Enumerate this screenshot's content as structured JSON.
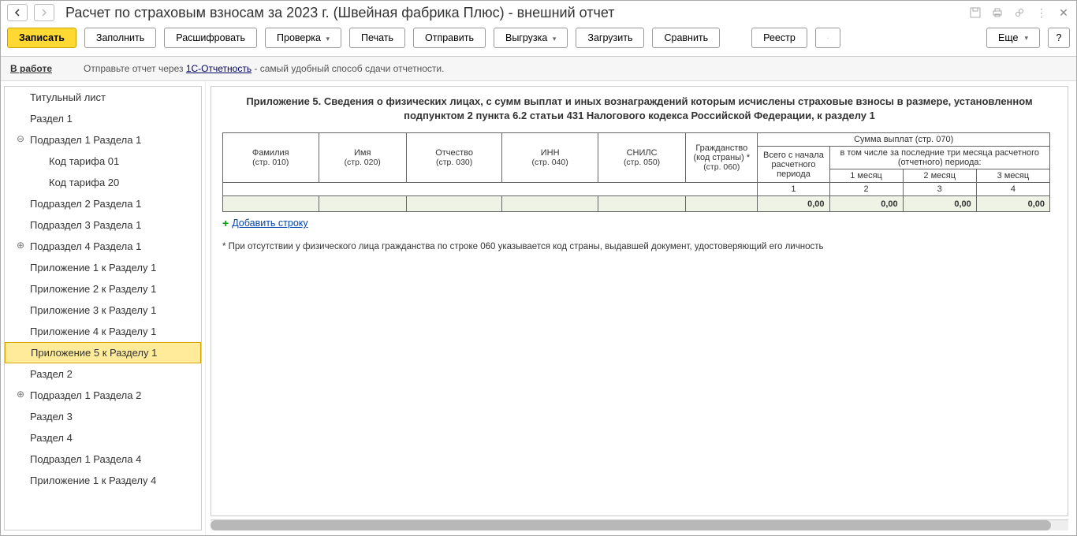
{
  "window": {
    "title": "Расчет по страховым взносам за 2023 г. (Швейная фабрика Плюс) - внешний отчет"
  },
  "toolbar": {
    "save": "Записать",
    "fill": "Заполнить",
    "decode": "Расшифровать",
    "check": "Проверка",
    "print": "Печать",
    "send": "Отправить",
    "export": "Выгрузка",
    "load": "Загрузить",
    "compare": "Сравнить",
    "registry": "Реестр",
    "more": "Еще",
    "help": "?"
  },
  "status": {
    "state": "В работе",
    "msg_pre": "Отправьте отчет через ",
    "msg_link": "1С-Отчетность",
    "msg_post": " - самый удобный способ сдачи отчетности."
  },
  "tree": [
    {
      "label": "Титульный лист",
      "level": 1
    },
    {
      "label": "Раздел 1",
      "level": 1
    },
    {
      "label": "Подраздел 1 Раздела 1",
      "level": 1,
      "exp": "⊖"
    },
    {
      "label": "Код тарифа 01",
      "level": 2
    },
    {
      "label": "Код тарифа 20",
      "level": 2
    },
    {
      "label": "Подраздел 2 Раздела 1",
      "level": 1
    },
    {
      "label": "Подраздел 3 Раздела 1",
      "level": 1
    },
    {
      "label": "Подраздел 4 Раздела 1",
      "level": 1,
      "exp": "⊕"
    },
    {
      "label": "Приложение 1 к Разделу 1",
      "level": 1
    },
    {
      "label": "Приложение 2 к Разделу 1",
      "level": 1
    },
    {
      "label": "Приложение 3 к Разделу 1",
      "level": 1
    },
    {
      "label": "Приложение 4 к Разделу 1",
      "level": 1
    },
    {
      "label": "Приложение 5 к Разделу 1",
      "level": 1,
      "selected": true
    },
    {
      "label": "Раздел 2",
      "level": 1
    },
    {
      "label": "Подраздел 1 Раздела 2",
      "level": 1,
      "exp": "⊕"
    },
    {
      "label": "Раздел 3",
      "level": 1
    },
    {
      "label": "Раздел 4",
      "level": 1
    },
    {
      "label": "Подраздел 1 Раздела 4",
      "level": 1
    },
    {
      "label": "Приложение 1 к Разделу 4",
      "level": 1
    }
  ],
  "sheet": {
    "title": "Приложение 5. Сведения о физических лицах, с сумм выплат и иных вознаграждений которым исчислены страховые взносы в размере, установленном подпунктом 2 пункта 6.2 статьи 431 Налогового кодекса Российской Федерации, к разделу 1",
    "cols": {
      "surname": "Фамилия",
      "surname_s": "(стр. 010)",
      "name": "Имя",
      "name_s": "(стр. 020)",
      "patr": "Отчество",
      "patr_s": "(стр. 030)",
      "inn": "ИНН",
      "inn_s": "(стр. 040)",
      "snils": "СНИЛС",
      "snils_s": "(стр. 050)",
      "citizen": "Гражданство (код страны) *",
      "citizen_s": "(стр. 060)",
      "sum_hdr": "Сумма выплат (стр. 070)",
      "total": "Всего с начала расчетного периода",
      "last3": "в том числе за последние три месяца расчетного (отчетного) периода:",
      "m1": "1 месяц",
      "m2": "2 месяц",
      "m3": "3 месяц",
      "n1": "1",
      "n2": "2",
      "n3": "3",
      "n4": "4"
    },
    "row": {
      "v1": "0,00",
      "v2": "0,00",
      "v3": "0,00",
      "v4": "0,00"
    },
    "add_row": "Добавить строку",
    "footnote": "* При отсутствии у физического лица гражданства по строке 060 указывается код страны, выдавшей документ, удостоверяющий его личность"
  }
}
